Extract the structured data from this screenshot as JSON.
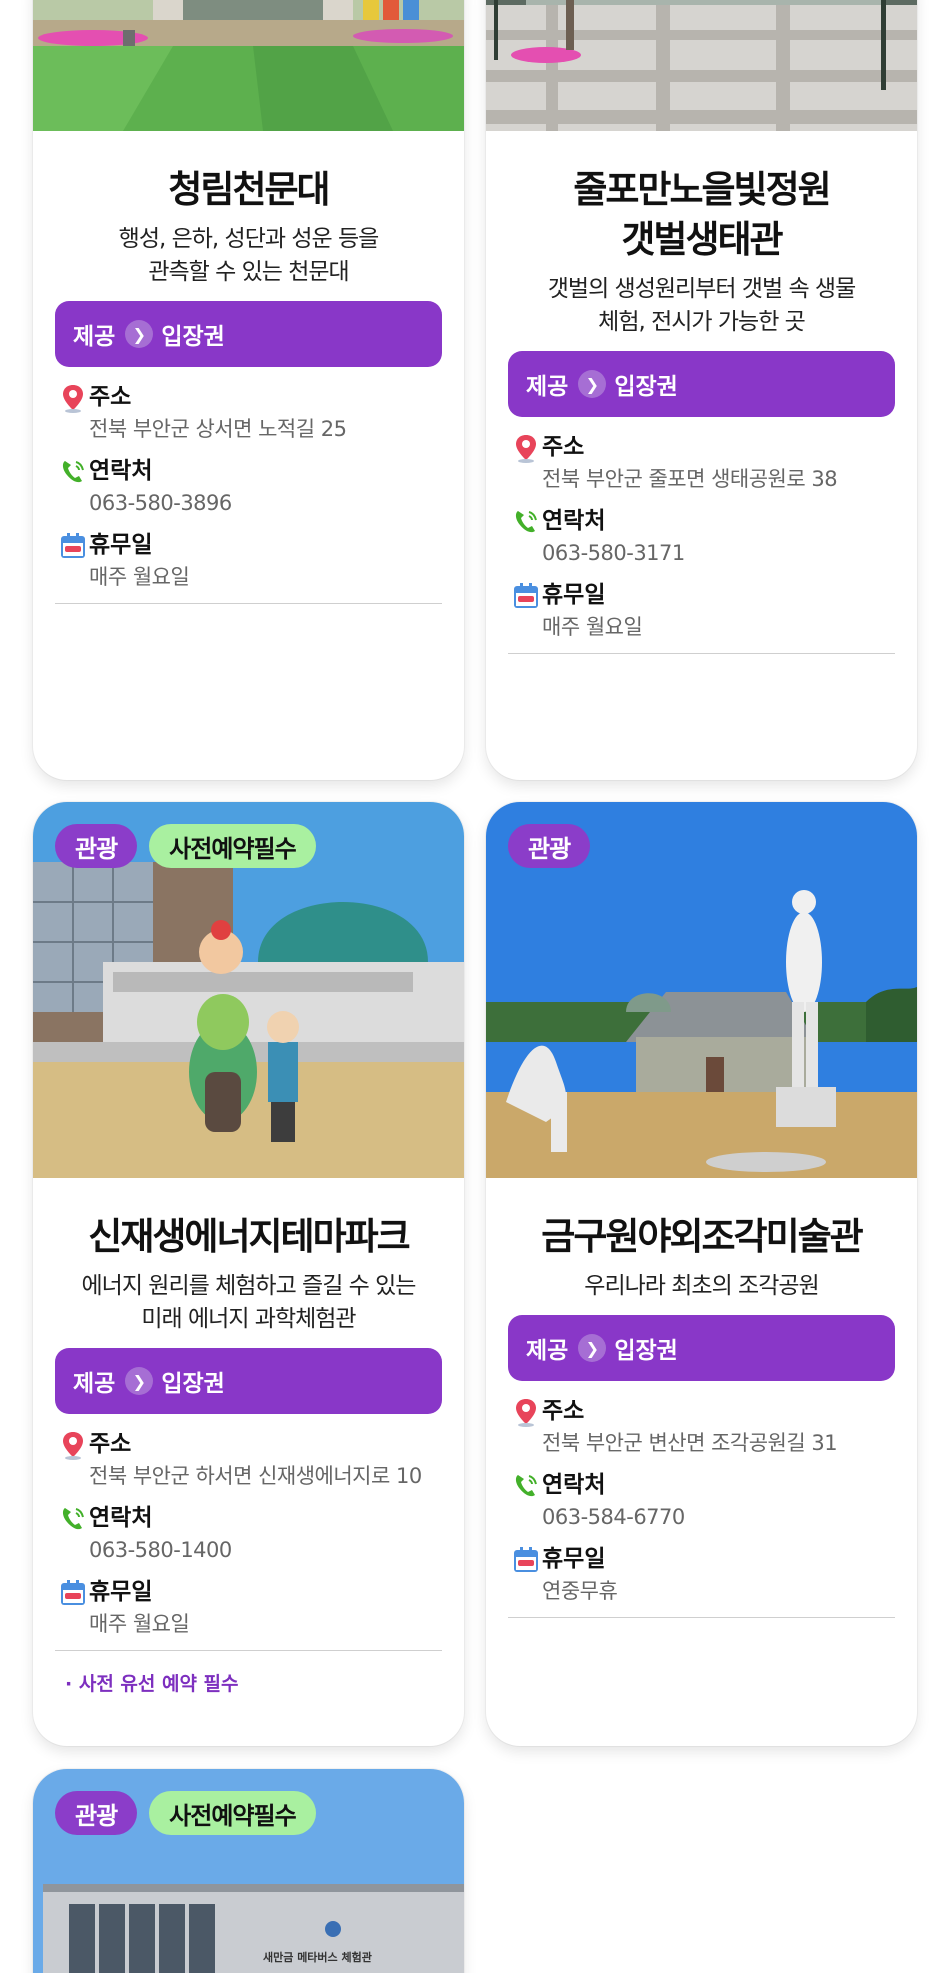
{
  "labels": {
    "offer_prefix": "제공",
    "badge_tour": "관광",
    "badge_reserve": "사전예약필수"
  },
  "colors": {
    "accent_purple": "#8937c8",
    "badge_green": "#a9f0a0",
    "pin_red": "#e8445a",
    "phone_green": "#43b02a"
  },
  "cards": [
    {
      "title": "청림천문대",
      "desc": [
        "행성, 은하, 성단과 성운 등을",
        "관측할 수 있는 천문대"
      ],
      "offer": "입장권",
      "address_label": "주소",
      "address": "전북 부안군 상서면 노적길 25",
      "contact_label": "연락처",
      "contact": "063-580-3896",
      "closed_label": "휴무일",
      "closed": "매주 월요일"
    },
    {
      "title_lines": [
        "줄포만노을빛정원",
        "갯벌생태관"
      ],
      "desc": [
        "갯벌의 생성원리부터 갯벌 속 생물",
        "체험, 전시가 가능한 곳"
      ],
      "offer": "입장권",
      "address_label": "주소",
      "address": "전북 부안군 줄포면 생태공원로 38",
      "contact_label": "연락처",
      "contact": "063-580-3171",
      "closed_label": "휴무일",
      "closed": "매주 월요일"
    },
    {
      "title": "신재생에너지테마파크",
      "desc": [
        "에너지 원리를 체험하고 즐길 수 있는",
        "미래 에너지 과학체험관"
      ],
      "offer": "입장권",
      "address_label": "주소",
      "address": "전북 부안군 하서면 신재생에너지로 10",
      "contact_label": "연락처",
      "contact": "063-580-1400",
      "closed_label": "휴무일",
      "closed": "매주 월요일",
      "note": "· 사전 유선 예약 필수"
    },
    {
      "title": "금구원야외조각미술관",
      "desc": [
        "우리나라 최초의 조각공원"
      ],
      "offer": "입장권",
      "address_label": "주소",
      "address": "전북 부안군 변산면 조각공원길 31",
      "contact_label": "연락처",
      "contact": "063-584-6770",
      "closed_label": "휴무일",
      "closed": "연중무휴"
    },
    {
      "building_sign": "새만금 메타버스 체험관"
    }
  ],
  "icons": {
    "address": "map-pin-icon",
    "contact": "phone-icon",
    "closed": "calendar-day-icon",
    "offer_arrow": "chevron-right-icon"
  }
}
